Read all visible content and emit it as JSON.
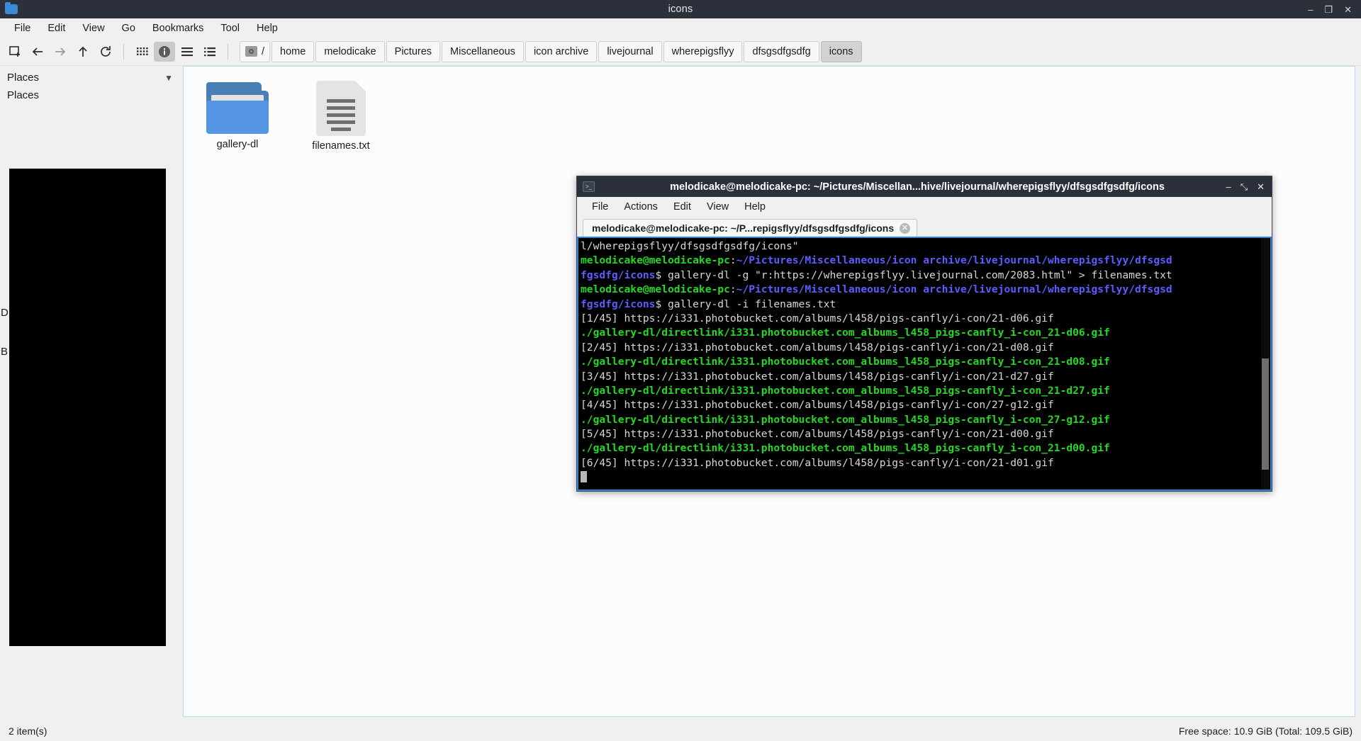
{
  "file_manager": {
    "title": "icons",
    "window_buttons": {
      "minimize": "–",
      "maximize": "❐",
      "close": "✕"
    },
    "menu": [
      "File",
      "Edit",
      "View",
      "Go",
      "Bookmarks",
      "Tool",
      "Help"
    ],
    "toolbar_icons": [
      "new-tab-icon",
      "back-icon",
      "forward-icon",
      "up-icon",
      "reload-icon",
      "icon-view-icon",
      "detail-info-icon",
      "list-view-icon",
      "compact-view-icon"
    ],
    "breadcrumb": {
      "root_label": "/",
      "root_icon": "disk-icon",
      "items": [
        "home",
        "melodicake",
        "Pictures",
        "Miscellaneous",
        "icon archive",
        "livejournal",
        "wherepigsflyy",
        "dfsgsdfgsdfg",
        "icons"
      ],
      "current": "icons"
    },
    "sidebar": {
      "header": "Places",
      "collapse_icon": "chevron-down-icon",
      "subheader": "Places",
      "occluded_letters": [
        "D",
        "B"
      ]
    },
    "files": [
      {
        "name": "gallery-dl",
        "type": "folder",
        "icon": "folder-icon"
      },
      {
        "name": "filenames.txt",
        "type": "text",
        "icon": "text-file-icon"
      }
    ],
    "status": {
      "left": "2 item(s)",
      "right": "Free space: 10.9 GiB (Total: 109.5 GiB)"
    }
  },
  "terminal": {
    "title": "melodicake@melodicake-pc: ~/Pictures/Miscellan...hive/livejournal/wherepigsflyy/dfsgsdfgsdfg/icons",
    "title_icon": "terminal-icon",
    "window_buttons": {
      "minimize": "–",
      "maximize": "⤡",
      "close": "✕"
    },
    "menu": [
      "File",
      "Actions",
      "Edit",
      "View",
      "Help"
    ],
    "tab": {
      "label": "melodicake@melodicake-pc: ~/P...repigsflyy/dfsgsdfgsdfg/icons",
      "close_icon": "close-tab-icon",
      "close_glyph": "✕"
    },
    "colors": {
      "green": "#26d826",
      "blue": "#5c5cff",
      "white": "#d7d7d7",
      "background": "#000000",
      "border": "#2f86d8"
    },
    "lines": [
      [
        {
          "t": "l/wherepigsflyy/dfsgsdfgsdfg/icons\"",
          "c": "white"
        }
      ],
      [
        {
          "t": "melodicake@melodicake-pc",
          "c": "green"
        },
        {
          "t": ":",
          "c": "white"
        },
        {
          "t": "~/Pictures/Miscellaneous/icon archive/livejournal/wherepigsflyy/dfsgsd",
          "c": "blue"
        }
      ],
      [
        {
          "t": "fgsdfg/icons",
          "c": "blue"
        },
        {
          "t": "$ gallery-dl -g \"r:https://wherepigsflyy.livejournal.com/2083.html\" > filenames.txt",
          "c": "white"
        }
      ],
      [
        {
          "t": "melodicake@melodicake-pc",
          "c": "green"
        },
        {
          "t": ":",
          "c": "white"
        },
        {
          "t": "~/Pictures/Miscellaneous/icon archive/livejournal/wherepigsflyy/dfsgsd",
          "c": "blue"
        }
      ],
      [
        {
          "t": "fgsdfg/icons",
          "c": "blue"
        },
        {
          "t": "$ gallery-dl -i filenames.txt",
          "c": "white"
        }
      ],
      [
        {
          "t": "[1/45] https://i331.photobucket.com/albums/l458/pigs-canfly/i-con/21-d06.gif",
          "c": "white"
        }
      ],
      [
        {
          "t": "./gallery-dl/directlink/i331.photobucket.com_albums_l458_pigs-canfly_i-con_21-d06.gif",
          "c": "green"
        }
      ],
      [
        {
          "t": "[2/45] https://i331.photobucket.com/albums/l458/pigs-canfly/i-con/21-d08.gif",
          "c": "white"
        }
      ],
      [
        {
          "t": "./gallery-dl/directlink/i331.photobucket.com_albums_l458_pigs-canfly_i-con_21-d08.gif",
          "c": "green"
        }
      ],
      [
        {
          "t": "[3/45] https://i331.photobucket.com/albums/l458/pigs-canfly/i-con/21-d27.gif",
          "c": "white"
        }
      ],
      [
        {
          "t": "./gallery-dl/directlink/i331.photobucket.com_albums_l458_pigs-canfly_i-con_21-d27.gif",
          "c": "green"
        }
      ],
      [
        {
          "t": "[4/45] https://i331.photobucket.com/albums/l458/pigs-canfly/i-con/27-g12.gif",
          "c": "white"
        }
      ],
      [
        {
          "t": "./gallery-dl/directlink/i331.photobucket.com_albums_l458_pigs-canfly_i-con_27-g12.gif",
          "c": "green"
        }
      ],
      [
        {
          "t": "[5/45] https://i331.photobucket.com/albums/l458/pigs-canfly/i-con/21-d00.gif",
          "c": "white"
        }
      ],
      [
        {
          "t": "./gallery-dl/directlink/i331.photobucket.com_albums_l458_pigs-canfly_i-con_21-d00.gif",
          "c": "green"
        }
      ],
      [
        {
          "t": "[6/45] https://i331.photobucket.com/albums/l458/pigs-canfly/i-con/21-d01.gif",
          "c": "white"
        }
      ]
    ],
    "cursor": true
  }
}
